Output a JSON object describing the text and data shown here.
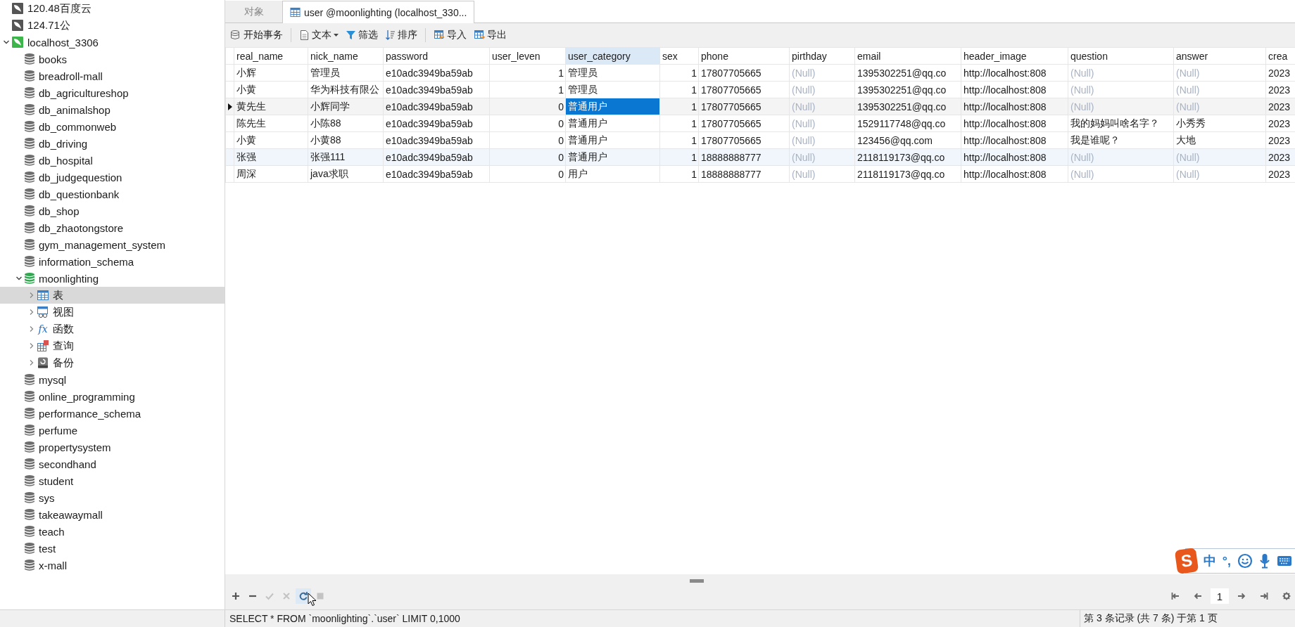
{
  "sidebar": {
    "items": [
      {
        "kind": "connection",
        "label": "120.48百度云",
        "open": false
      },
      {
        "kind": "connection",
        "label": "124.71公",
        "open": false
      },
      {
        "kind": "connection",
        "label": "localhost_3306",
        "open": true,
        "expanded": true,
        "children": [
          {
            "kind": "database",
            "label": "books",
            "open": false
          },
          {
            "kind": "database",
            "label": "breadroll-mall",
            "open": false
          },
          {
            "kind": "database",
            "label": "db_agricultureshop",
            "open": false
          },
          {
            "kind": "database",
            "label": "db_animalshop",
            "open": false
          },
          {
            "kind": "database",
            "label": "db_commonweb",
            "open": false
          },
          {
            "kind": "database",
            "label": "db_driving",
            "open": false
          },
          {
            "kind": "database",
            "label": "db_hospital",
            "open": false
          },
          {
            "kind": "database",
            "label": "db_judgequestion",
            "open": false
          },
          {
            "kind": "database",
            "label": "db_questionbank",
            "open": false
          },
          {
            "kind": "database",
            "label": "db_shop",
            "open": false
          },
          {
            "kind": "database",
            "label": "db_zhaotongstore",
            "open": false
          },
          {
            "kind": "database",
            "label": "gym_management_system",
            "open": false
          },
          {
            "kind": "database",
            "label": "information_schema",
            "open": false
          },
          {
            "kind": "database",
            "label": "moonlighting",
            "open": true,
            "expanded": true,
            "children": [
              {
                "kind": "tables",
                "label": "表",
                "expanded": false,
                "selected": true
              },
              {
                "kind": "views",
                "label": "视图",
                "expanded": false,
                "selected": false
              },
              {
                "kind": "functions",
                "label": "函数",
                "icon_text": "fx",
                "expanded": false,
                "selected": false
              },
              {
                "kind": "queries",
                "label": "查询",
                "expanded": false,
                "selected": false
              },
              {
                "kind": "backups",
                "label": "备份",
                "expanded": false,
                "selected": false
              }
            ]
          },
          {
            "kind": "database",
            "label": "mysql",
            "open": false
          },
          {
            "kind": "database",
            "label": "online_programming",
            "open": false
          },
          {
            "kind": "database",
            "label": "performance_schema",
            "open": false
          },
          {
            "kind": "database",
            "label": "perfume",
            "open": false
          },
          {
            "kind": "database",
            "label": "propertysystem",
            "open": false
          },
          {
            "kind": "database",
            "label": "secondhand",
            "open": false
          },
          {
            "kind": "database",
            "label": "student",
            "open": false
          },
          {
            "kind": "database",
            "label": "sys",
            "open": false
          },
          {
            "kind": "database",
            "label": "takeawaymall",
            "open": false
          },
          {
            "kind": "database",
            "label": "teach",
            "open": false
          },
          {
            "kind": "database",
            "label": "test",
            "open": false
          },
          {
            "kind": "database",
            "label": "x-mall",
            "open": false
          }
        ]
      }
    ]
  },
  "tabs": [
    {
      "label": "对象",
      "selected": false,
      "kind": "objects"
    },
    {
      "label": "user @moonlighting (localhost_330...",
      "selected": true,
      "kind": "table"
    }
  ],
  "toolbar": [
    {
      "kind": "transaction",
      "label": "开始事务"
    },
    {
      "kind": "text",
      "label": "文本"
    },
    {
      "kind": "filter",
      "label": "筛选"
    },
    {
      "kind": "sort",
      "label": "排序"
    },
    {
      "kind": "import",
      "label": "导入"
    },
    {
      "kind": "export",
      "label": "导出"
    }
  ],
  "table": {
    "columns": [
      {
        "name": "real_name",
        "numeric": false,
        "focused": false
      },
      {
        "name": "nick_name",
        "numeric": false,
        "focused": false
      },
      {
        "name": "password",
        "numeric": false,
        "focused": false
      },
      {
        "name": "user_leven",
        "numeric": true,
        "focused": false
      },
      {
        "name": "user_category",
        "numeric": false,
        "focused": true
      },
      {
        "name": "sex",
        "numeric": true,
        "focused": false
      },
      {
        "name": "phone",
        "numeric": false,
        "focused": false
      },
      {
        "name": "pirthday",
        "numeric": false,
        "focused": false
      },
      {
        "name": "email",
        "numeric": false,
        "focused": false
      },
      {
        "name": "header_image",
        "numeric": false,
        "focused": false
      },
      {
        "name": "question",
        "numeric": false,
        "focused": false
      },
      {
        "name": "answer",
        "numeric": false,
        "focused": false
      },
      {
        "name": "crea",
        "numeric": false,
        "focused": false
      }
    ],
    "rows": [
      {
        "selected": false,
        "hovered": false,
        "cells": [
          "小辉",
          "管理员",
          "e10adc3949ba59ab",
          "1",
          "管理员",
          "1",
          "17807705665",
          {
            "text": "(Null)",
            "null": true
          },
          "1395302251@qq.co",
          "http://localhost:808",
          {
            "text": "(Null)",
            "null": true
          },
          {
            "text": "(Null)",
            "null": true
          },
          "2023"
        ]
      },
      {
        "selected": false,
        "hovered": false,
        "cells": [
          "小黄",
          "华为科技有限公",
          "e10adc3949ba59ab",
          "1",
          "管理员",
          "1",
          "17807705665",
          {
            "text": "(Null)",
            "null": true
          },
          "1395302251@qq.co",
          "http://localhost:808",
          {
            "text": "(Null)",
            "null": true
          },
          {
            "text": "(Null)",
            "null": true
          },
          "2023"
        ]
      },
      {
        "selected": true,
        "hovered": false,
        "cells": [
          "黄先生",
          "小辉同学",
          "e10adc3949ba59ab",
          "0",
          "普通用户",
          "1",
          "17807705665",
          {
            "text": "(Null)",
            "null": true
          },
          "1395302251@qq.co",
          "http://localhost:808",
          {
            "text": "(Null)",
            "null": true
          },
          {
            "text": "(Null)",
            "null": true
          },
          "2023"
        ]
      },
      {
        "selected": false,
        "hovered": false,
        "cells": [
          "陈先生",
          "小陈88",
          "e10adc3949ba59ab",
          "0",
          "普通用户",
          "1",
          "17807705665",
          {
            "text": "(Null)",
            "null": true
          },
          "1529117748@qq.co",
          "http://localhost:808",
          "我的妈妈叫啥名字？",
          "小秀秀",
          "2023"
        ]
      },
      {
        "selected": false,
        "hovered": false,
        "cells": [
          "小黄",
          "小黄88",
          "e10adc3949ba59ab",
          "0",
          "普通用户",
          "1",
          "17807705665",
          {
            "text": "(Null)",
            "null": true
          },
          "123456@qq.com",
          "http://localhost:808",
          "我是谁呢？",
          "大地",
          "2023"
        ]
      },
      {
        "selected": false,
        "hovered": true,
        "cells": [
          "张强",
          "张强111",
          "e10adc3949ba59ab",
          "0",
          "普通用户",
          "1",
          "18888888777",
          {
            "text": "(Null)",
            "null": true
          },
          "2118119173@qq.co",
          "http://localhost:808",
          {
            "text": "(Null)",
            "null": true
          },
          {
            "text": "(Null)",
            "null": true
          },
          "2023"
        ]
      },
      {
        "selected": false,
        "hovered": false,
        "cells": [
          "周深",
          "java求职",
          "e10adc3949ba59ab",
          "0",
          "用户",
          "1",
          "18888888777",
          {
            "text": "(Null)",
            "null": true
          },
          "2118119173@qq.co",
          "http://localhost:808",
          {
            "text": "(Null)",
            "null": true
          },
          {
            "text": "(Null)",
            "null": true
          },
          "2023"
        ]
      }
    ]
  },
  "record_toolbar": [
    {
      "kind": "add",
      "disabled": false,
      "hovered": false
    },
    {
      "kind": "delete",
      "disabled": false,
      "hovered": false
    },
    {
      "kind": "apply",
      "disabled": true,
      "hovered": false
    },
    {
      "kind": "discard",
      "disabled": true,
      "hovered": false
    },
    {
      "kind": "refresh",
      "disabled": false,
      "hovered": true
    },
    {
      "kind": "stop",
      "disabled": true,
      "hovered": false
    }
  ],
  "pagination": {
    "page": "1"
  },
  "ime_toolbar": {
    "logo": "S",
    "mode": "中",
    "punctuation": "°,"
  },
  "status_bar": {
    "query": "SELECT * FROM `moonlighting`.`user` LIMIT 0,1000",
    "record_info": "第 3 条记录 (共 7 条) 于第 1 页"
  }
}
